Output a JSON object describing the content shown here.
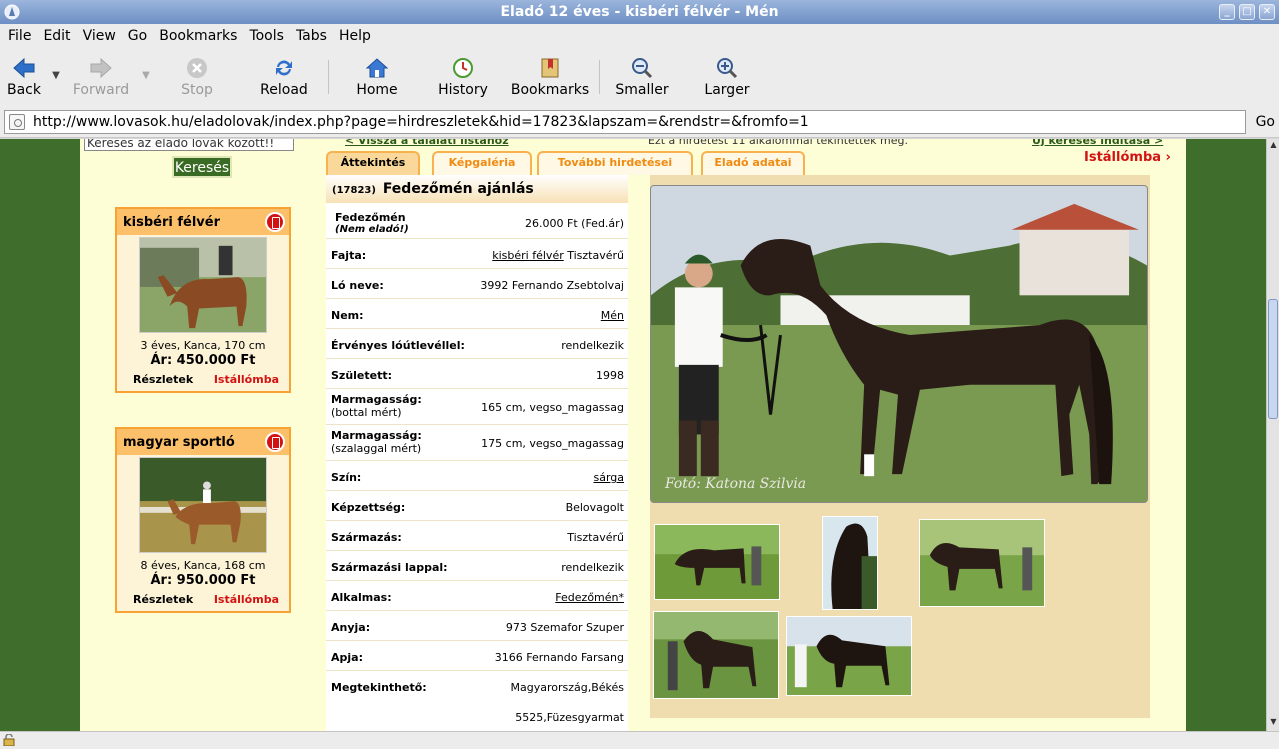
{
  "window": {
    "title": "Eladó 12 éves - kisbéri félvér - Mén"
  },
  "menu": [
    "File",
    "Edit",
    "View",
    "Go",
    "Bookmarks",
    "Tools",
    "Tabs",
    "Help"
  ],
  "toolbar": {
    "back": "Back",
    "forward": "Forward",
    "stop": "Stop",
    "reload": "Reload",
    "home": "Home",
    "history": "History",
    "bookmarks": "Bookmarks",
    "smaller": "Smaller",
    "larger": "Larger"
  },
  "address": {
    "url": "http://www.lovasok.hu/eladolovak/index.php?page=hirdreszletek&hid=17823&lapszam=&rendstr=&fromfo=1",
    "go": "Go"
  },
  "sidebar": {
    "search_value": "Keresés az eladó lovak között!!",
    "search_button": "Keresés",
    "ads": [
      {
        "breed": "kisbéri félvér",
        "info": "3 éves, Kanca, 170 cm",
        "price": "Ár: 450.000 Ft",
        "details": "Részletek",
        "stable": "Istállómba"
      },
      {
        "breed": "magyar sportló",
        "info": "8 éves, Kanca, 168 cm",
        "price": "Ár: 950.000 Ft",
        "details": "Részletek",
        "stable": "Istállómba"
      }
    ]
  },
  "toplinks": {
    "back": "< Vissza a találati listához",
    "views": "Ezt a hirdetést 11 alkalommal tekintették meg.",
    "new_search": "Új keresés indítása >",
    "stable": "Istállómba ›"
  },
  "tabs": [
    "Áttekintés",
    "Képgaléria",
    "További hirdetései",
    "Eladó adatai"
  ],
  "listing": {
    "id": "(17823)",
    "title": "Fedezőmén ajánlás",
    "rows": [
      {
        "label": "Fedezőmén",
        "sub": "(Nem eladó!)",
        "value": "26.000 Ft (Fed.ár)"
      },
      {
        "label": "Fajta:",
        "value": "kisbéri félvér",
        "value2": " Tisztavérű"
      },
      {
        "label": "Ló neve:",
        "value": "3992 Fernando Zsebtolvaj"
      },
      {
        "label": "Nem:",
        "value": "Mén"
      },
      {
        "label": "Érvényes lóútlevéllel:",
        "value": "rendelkezik"
      },
      {
        "label": "Született:",
        "value": "1998"
      },
      {
        "label": "Marmagasság:",
        "sub": "(bottal mért)",
        "value": "165 cm, vegso_magassag"
      },
      {
        "label": "Marmagasság:",
        "sub": "(szalaggal mért)",
        "value": "175 cm, vegso_magassag"
      },
      {
        "label": "Szín:",
        "value": "sárga"
      },
      {
        "label": "Képzettség:",
        "value": "Belovagolt"
      },
      {
        "label": "Származás:",
        "value": "Tisztavérű"
      },
      {
        "label": "Származási lappal:",
        "value": "rendelkezik"
      },
      {
        "label": "Alkalmas:",
        "value": "Fedezőmén*"
      },
      {
        "label": "Anyja:",
        "value": "973 Szemafor Szuper"
      },
      {
        "label": "Apja:",
        "value": "3166 Fernando Farsang"
      },
      {
        "label": "Megtekinthető:",
        "value": "Magyarország,Békés",
        "value2": "5525,Füzesgyarmat"
      }
    ]
  },
  "photo_caption": "Fotó: Katona Szilvia"
}
